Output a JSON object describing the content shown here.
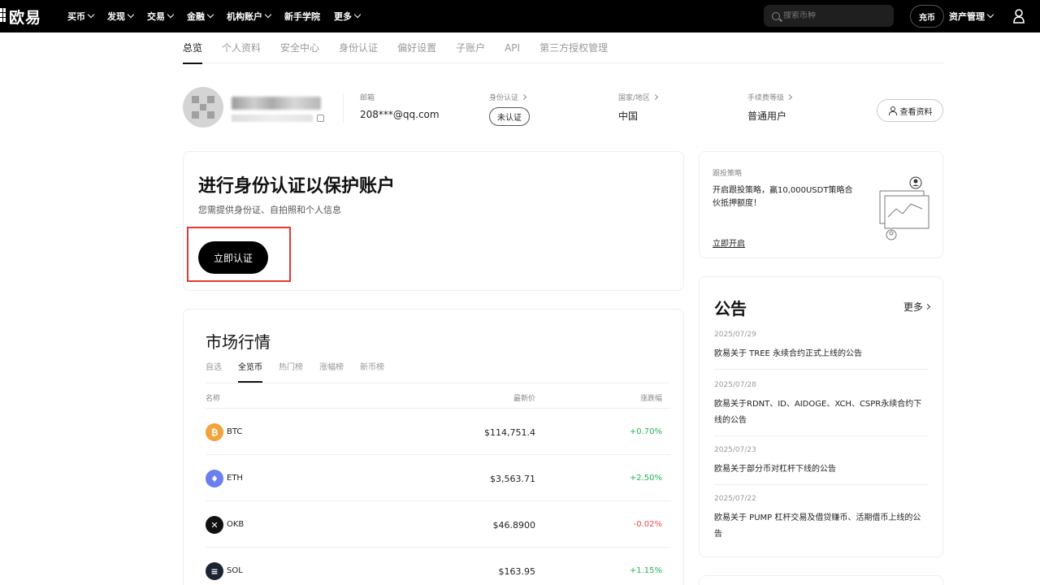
{
  "nav": {
    "logo": "欧易",
    "items": [
      {
        "label": "买币"
      },
      {
        "label": "发现"
      },
      {
        "label": "交易"
      },
      {
        "label": "金融"
      },
      {
        "label": "机构账户"
      },
      {
        "label": "新手学院",
        "no_chevron": true
      },
      {
        "label": "更多"
      }
    ],
    "search_placeholder": "搜索币种",
    "pill_label": "充币",
    "asset_label": "资产管理"
  },
  "tabs": [
    {
      "label": "总览",
      "active": true
    },
    {
      "label": "个人资料"
    },
    {
      "label": "安全中心"
    },
    {
      "label": "身份认证"
    },
    {
      "label": "偏好设置"
    },
    {
      "label": "子账户"
    },
    {
      "label": "API"
    },
    {
      "label": "第三方授权管理"
    }
  ],
  "profile": {
    "email_label": "邮箱",
    "email_value": "208***@qq.com",
    "kyc_label": "身份认证",
    "kyc_value": "未认证",
    "region_label": "国家/地区",
    "region_value": "中国",
    "fee_label": "手续费等级",
    "fee_value": "普通用户",
    "view_profile": "查看资料"
  },
  "verify": {
    "title": "进行身份认证以保护账户",
    "subtitle": "您需提供身份证、自拍照和个人信息",
    "button": "立即认证"
  },
  "market": {
    "title": "市场行情",
    "tabs": [
      {
        "label": "自选"
      },
      {
        "label": "全览币",
        "active": true
      },
      {
        "label": "热门榜"
      },
      {
        "label": "涨幅榜"
      },
      {
        "label": "新币榜"
      }
    ],
    "col_name": "名称",
    "col_price": "最新价",
    "col_change": "涨跌幅",
    "rows": [
      {
        "symbol": "BTC",
        "price": "$114,751.4",
        "change": "+0.70%",
        "color": "#f2a33a",
        "glyph": "₿",
        "dir": "up"
      },
      {
        "symbol": "ETH",
        "price": "$3,563.71",
        "change": "+2.50%",
        "color": "#6b7ff0",
        "glyph": "♦",
        "dir": "up"
      },
      {
        "symbol": "OKB",
        "price": "$46.8900",
        "change": "-0.02%",
        "color": "#111111",
        "glyph": "✕",
        "dir": "down"
      },
      {
        "symbol": "SOL",
        "price": "$163.95",
        "change": "+1.15%",
        "color": "#1c2433",
        "glyph": "≡",
        "dir": "up"
      }
    ]
  },
  "promo": {
    "label": "跟投策略",
    "text": "开启跟投策略，赢10,000USDT策略合伙抵押额度！",
    "link": "立即开启"
  },
  "notice": {
    "title": "公告",
    "more": "更多",
    "items": [
      {
        "date": "2025/07/29",
        "text": "欧易关于 TREE 永续合约正式上线的公告"
      },
      {
        "date": "2025/07/28",
        "text": "欧易关于RDNT、ID、AIDOGE、XCH、CSPR永续合约下线的公告"
      },
      {
        "date": "2025/07/23",
        "text": "欧易关于部分币对杠杆下线的公告"
      },
      {
        "date": "2025/07/22",
        "text": "欧易关于 PUMP 杠杆交易及借贷赚币、活期借币上线的公告"
      }
    ]
  },
  "colors": {
    "accent": "#000000",
    "up": "#21b359",
    "down": "#e5484d",
    "highlight": "#e53935"
  }
}
